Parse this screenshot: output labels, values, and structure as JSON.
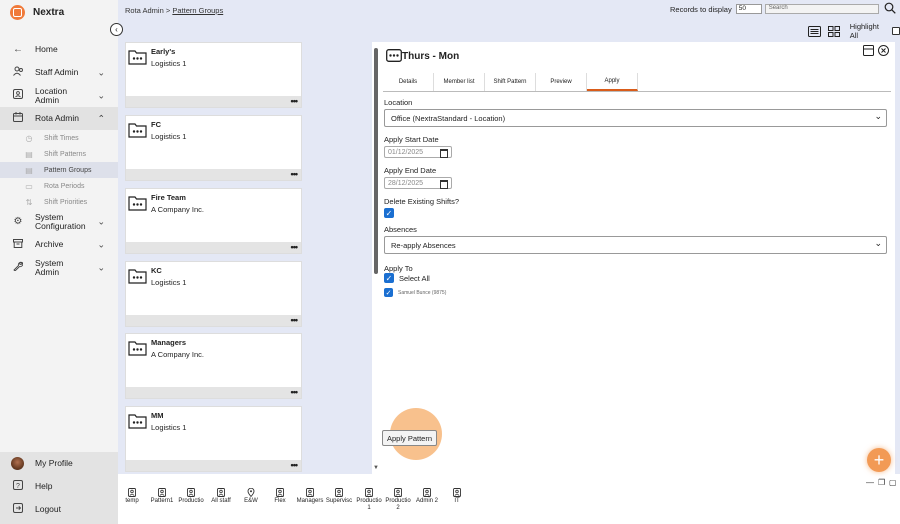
{
  "app": {
    "name": "Nextra"
  },
  "nav": {
    "items": [
      {
        "id": "home",
        "label": "Home",
        "icon": "←",
        "chevron": ""
      },
      {
        "id": "staff",
        "label": "Staff Admin",
        "icon": "👥",
        "chevron": "⌄"
      },
      {
        "id": "location",
        "label": "Location Admin",
        "icon": "▣",
        "chevron": "⌄"
      },
      {
        "id": "rota",
        "label": "Rota Admin",
        "icon": "▦",
        "chevron": "⌃"
      }
    ],
    "sub_items": [
      {
        "label": "Shift Times",
        "icon": "◷"
      },
      {
        "label": "Shift Patterns",
        "icon": "▤"
      },
      {
        "label": "Pattern Groups",
        "icon": "▤"
      },
      {
        "label": "Rota Periods",
        "icon": "▭"
      },
      {
        "label": "Shift Priorities",
        "icon": "⇅"
      }
    ],
    "items_after": [
      {
        "id": "system-config",
        "label": "System Configuration",
        "icon": "⚙",
        "chevron": "⌄"
      },
      {
        "id": "archive",
        "label": "Archive",
        "icon": "▤",
        "chevron": "⌄"
      },
      {
        "id": "system-admin",
        "label": "System Admin",
        "icon": "✎",
        "chevron": "⌄"
      }
    ],
    "bottom": [
      {
        "label": "My Profile"
      },
      {
        "label": "Help",
        "icon": "?"
      },
      {
        "label": "Logout",
        "icon": "⇥"
      }
    ]
  },
  "breadcrumb": {
    "root": "Rota Admin",
    "sep": ">",
    "current": "Pattern Groups"
  },
  "toolbar": {
    "records_label": "Records to display",
    "records_value": "50",
    "search_placeholder": "Search",
    "highlight_label": "Highlight All"
  },
  "cards": [
    {
      "title": "Early's",
      "subtitle": "Logistics 1"
    },
    {
      "title": "FC",
      "subtitle": "Logistics 1"
    },
    {
      "title": "Fire Team",
      "subtitle": "A Company Inc."
    },
    {
      "title": "KC",
      "subtitle": "Logistics 1"
    },
    {
      "title": "Managers",
      "subtitle": "A Company Inc."
    },
    {
      "title": "MM",
      "subtitle": "Logistics 1"
    }
  ],
  "card_more": "•••",
  "panel": {
    "title": "Thurs - Mon",
    "tabs": [
      "Details",
      "Member list",
      "Shift Pattern",
      "Preview",
      "Apply"
    ],
    "active_tab": 4,
    "form": {
      "location_label": "Location",
      "location_value": "Office (NextraStandard - Location)",
      "start_label": "Apply Start Date",
      "start_value": "01/12/2025",
      "end_label": "Apply End Date",
      "end_value": "28/12/2025",
      "delete_label": "Delete Existing Shifts?",
      "absences_label": "Absences",
      "absences_value": "Re-apply Absences",
      "apply_to_label": "Apply To",
      "select_all_label": "Select All",
      "member": "Samuel Bunce (9875)",
      "apply_button": "Apply Pattern"
    }
  },
  "bottom_bar": [
    {
      "label": "temp"
    },
    {
      "label": "Pattern1"
    },
    {
      "label": "Productio"
    },
    {
      "label": "All staff"
    },
    {
      "label": "E&W"
    },
    {
      "label": "Flex"
    },
    {
      "label": "Managers"
    },
    {
      "label": "Supervisc"
    },
    {
      "label": "Productio 1"
    },
    {
      "label": "Productio 2"
    },
    {
      "label": "Admin 2"
    },
    {
      "label": "IT"
    }
  ],
  "fab": "+",
  "colors": {
    "accent": "#d95c1a",
    "check": "#1a6fd1",
    "highlight": "#f5a050"
  }
}
